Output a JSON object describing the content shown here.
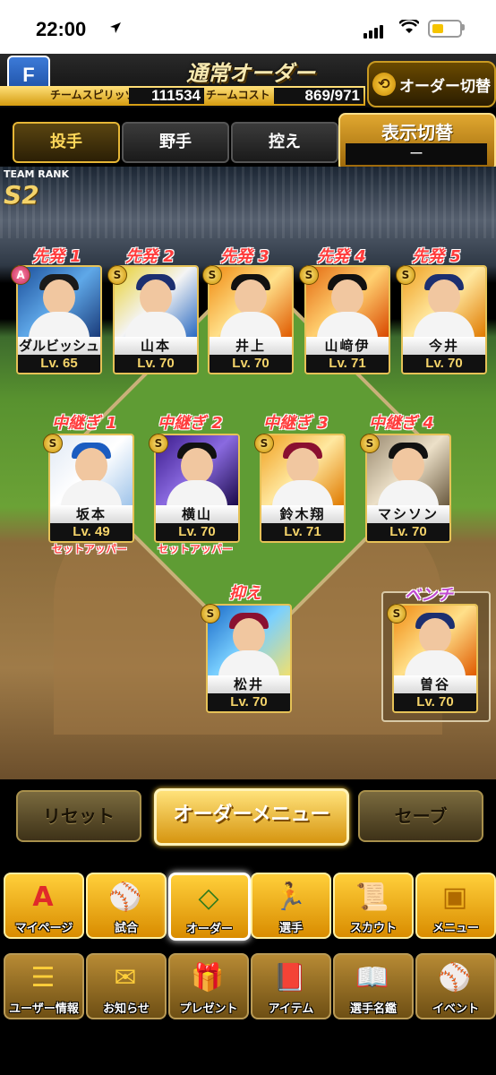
{
  "status": {
    "time": "22:00"
  },
  "header": {
    "title": "通常オーダー",
    "switch_order": "オーダー切替",
    "spirits_label": "チームスピリッツ",
    "spirits_value": "111534",
    "cost_label": "チームコスト",
    "cost_value": "869/971",
    "logo_letter": "F"
  },
  "tabs": [
    {
      "label": "投手"
    },
    {
      "label": "野手"
    },
    {
      "label": "控え"
    }
  ],
  "display_toggle": {
    "label": "表示切替",
    "value": "ー"
  },
  "team_rank": {
    "title": "TEAM RANK",
    "rank": "S2"
  },
  "starters": [
    {
      "slot": "先発 1",
      "name": "ダルビッシュ",
      "level": "Lv. 65",
      "badge": "A"
    },
    {
      "slot": "先発 2",
      "name": "山本",
      "level": "Lv. 70",
      "badge": "S"
    },
    {
      "slot": "先発 3",
      "name": "井上",
      "level": "Lv. 70",
      "badge": "S"
    },
    {
      "slot": "先発 4",
      "name": "山﨑伊",
      "level": "Lv. 71",
      "badge": "S"
    },
    {
      "slot": "先発 5",
      "name": "今井",
      "level": "Lv. 70",
      "badge": "S"
    }
  ],
  "relievers": [
    {
      "slot": "中継ぎ 1",
      "name": "坂本",
      "level": "Lv. 49",
      "badge": "S",
      "role": "セットアッパー"
    },
    {
      "slot": "中継ぎ 2",
      "name": "横山",
      "level": "Lv. 70",
      "badge": "S",
      "role": "セットアッパー"
    },
    {
      "slot": "中継ぎ 3",
      "name": "鈴木翔",
      "level": "Lv. 71",
      "badge": "S"
    },
    {
      "slot": "中継ぎ 4",
      "name": "マシソン",
      "level": "Lv. 70",
      "badge": "S"
    }
  ],
  "closer": {
    "slot": "抑え",
    "name": "松井",
    "level": "Lv. 70",
    "badge": "S"
  },
  "bench": {
    "slot": "ベンチ",
    "name": "曽谷",
    "level": "Lv. 70",
    "badge": "S"
  },
  "actions": {
    "reset": "リセット",
    "menu": "オーダーメニュー",
    "save": "セーブ"
  },
  "nav_main": [
    {
      "label": "マイページ",
      "icon": "A"
    },
    {
      "label": "試合",
      "icon": "⚾"
    },
    {
      "label": "オーダー",
      "icon": "◇"
    },
    {
      "label": "選手",
      "icon": "🏃"
    },
    {
      "label": "スカウト",
      "icon": "📜"
    },
    {
      "label": "メニュー",
      "icon": "▣"
    }
  ],
  "nav_sub": [
    {
      "label": "ユーザー情報",
      "icon": "☰"
    },
    {
      "label": "お知らせ",
      "icon": "✉"
    },
    {
      "label": "プレゼント",
      "icon": "🎁"
    },
    {
      "label": "アイテム",
      "icon": "📕"
    },
    {
      "label": "選手名鑑",
      "icon": "📖"
    },
    {
      "label": "イベント",
      "icon": "⚾"
    }
  ]
}
